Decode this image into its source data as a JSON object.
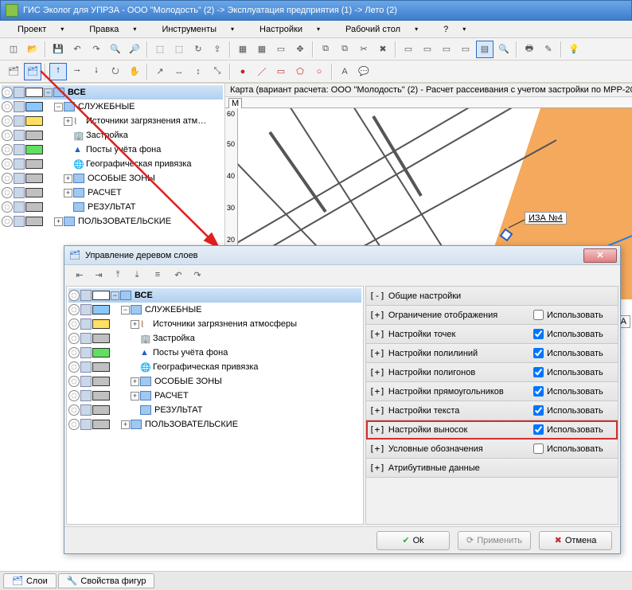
{
  "window": {
    "title": "ГИС Эколог для УПРЗА - ООО \"Молодость\" (2) -> Эксплуатация предприятия (1) -> Лето (2)"
  },
  "menu": {
    "project": "Проект",
    "edit": "Правка",
    "tools": "Инструменты",
    "settings": "Настройки",
    "desktop": "Рабочий стол",
    "help": "?"
  },
  "map": {
    "title": "Карта (вариант расчета: ООО \"Молодость\" (2) - Расчет рассеивания с учетом застройки по МРР-20",
    "m": "М",
    "iza": "ИЗА №4"
  },
  "tree": {
    "root": "ВСЕ",
    "service": "СЛУЖЕБНЫЕ",
    "sources": "Источники загрязнения атм…",
    "sources_full": "Источники загрязнения атмосферы",
    "build": "Застройка",
    "posts": "Посты учёта фона",
    "geo": "Географическая привязка",
    "zones": "ОСОБЫЕ ЗОНЫ",
    "calc": "РАСЧЕТ",
    "result": "РЕЗУЛЬТАТ",
    "user": "ПОЛЬЗОВАТЕЛЬСКИЕ"
  },
  "dialog": {
    "title": "Управление деревом слоев",
    "ok": "Ok",
    "apply": "Применить",
    "cancel": "Отмена"
  },
  "settings_panel": {
    "items": [
      {
        "pm": "[-]",
        "label": "Общие настройки",
        "chk": null
      },
      {
        "pm": "[+]",
        "label": "Ограничение отображения",
        "chk": false,
        "use": "Использовать"
      },
      {
        "pm": "[+]",
        "label": "Настройки точек",
        "chk": true,
        "use": "Использовать"
      },
      {
        "pm": "[+]",
        "label": "Настройки полилиний",
        "chk": true,
        "use": "Использовать"
      },
      {
        "pm": "[+]",
        "label": "Настройки полигонов",
        "chk": true,
        "use": "Использовать"
      },
      {
        "pm": "[+]",
        "label": "Настройки прямоугольников",
        "chk": true,
        "use": "Использовать"
      },
      {
        "pm": "[+]",
        "label": "Настройки текста",
        "chk": true,
        "use": "Использовать"
      },
      {
        "pm": "[+]",
        "label": "Настройки выносок",
        "chk": true,
        "use": "Использовать",
        "hl": true
      },
      {
        "pm": "[+]",
        "label": "Условные обозначения",
        "chk": false,
        "use": "Использовать"
      },
      {
        "pm": "[+]",
        "label": "Атрибутивные данные",
        "chk": null
      }
    ]
  },
  "tabs": {
    "layers": "Слои",
    "props": "Свойства фигур"
  },
  "side_label": "ИЗА"
}
